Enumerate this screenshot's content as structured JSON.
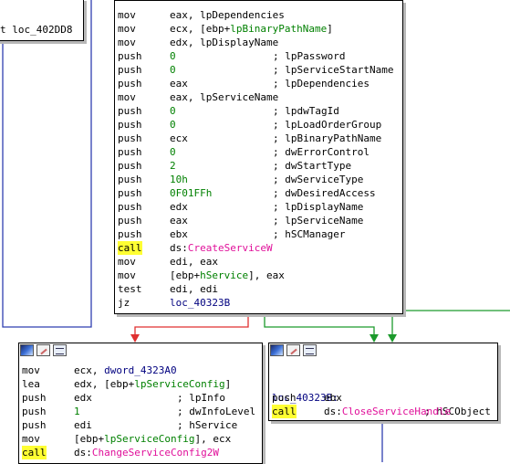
{
  "left_block": {
    "partial_line": "t loc_402DD8"
  },
  "main_block": {
    "lines": [
      {
        "m": "mov",
        "o": "eax, lpDependencies",
        "c": ""
      },
      {
        "m": "mov",
        "o": "ecx, [ebp+lpBinaryPathName]",
        "c": ""
      },
      {
        "m": "mov",
        "o": "edx, lpDisplayName",
        "c": ""
      },
      {
        "m": "push",
        "o": "0",
        "c": "; lpPassword"
      },
      {
        "m": "push",
        "o": "0",
        "c": "; lpServiceStartName"
      },
      {
        "m": "push",
        "o": "eax",
        "c": "; lpDependencies"
      },
      {
        "m": "mov",
        "o": "eax, lpServiceName",
        "c": ""
      },
      {
        "m": "push",
        "o": "0",
        "c": "; lpdwTagId"
      },
      {
        "m": "push",
        "o": "0",
        "c": "; lpLoadOrderGroup"
      },
      {
        "m": "push",
        "o": "ecx",
        "c": "; lpBinaryPathName"
      },
      {
        "m": "push",
        "o": "0",
        "c": "; dwErrorControl"
      },
      {
        "m": "push",
        "o": "2",
        "c": "; dwStartType"
      },
      {
        "m": "push",
        "o": "10h",
        "c": "; dwServiceType"
      },
      {
        "m": "push",
        "o": "0F01FFh",
        "c": "; dwDesiredAccess"
      },
      {
        "m": "push",
        "o": "edx",
        "c": "; lpDisplayName"
      },
      {
        "m": "push",
        "o": "eax",
        "c": "; lpServiceName"
      },
      {
        "m": "push",
        "o": "ebx",
        "c": "; hSCManager"
      },
      {
        "m": "call",
        "o": "ds:CreateServiceW",
        "c": ""
      },
      {
        "m": "mov",
        "o": "edi, eax",
        "c": ""
      },
      {
        "m": "mov",
        "o": "[ebp+hService], eax",
        "c": ""
      },
      {
        "m": "test",
        "o": "edi, edi",
        "c": ""
      },
      {
        "m": "jz",
        "o": "loc_40323B",
        "c": ""
      }
    ]
  },
  "bottom_left_block": {
    "lines": [
      {
        "m": "mov",
        "o": "ecx, dword_4323A0",
        "c": ""
      },
      {
        "m": "lea",
        "o": "edx, [ebp+lpServiceConfig]",
        "c": ""
      },
      {
        "m": "push",
        "o": "edx",
        "c": "; lpInfo"
      },
      {
        "m": "push",
        "o": "1",
        "c": "; dwInfoLevel"
      },
      {
        "m": "push",
        "o": "edi",
        "c": "; hService"
      },
      {
        "m": "mov",
        "o": "[ebp+lpServiceConfig], ecx",
        "c": ""
      },
      {
        "m": "call",
        "o": "ds:ChangeServiceConfig2W",
        "c": ""
      }
    ]
  },
  "bottom_right_block": {
    "label": "loc_40323B:",
    "label_comment": "; hSCObject",
    "lines": [
      {
        "m": "push",
        "o": "ebx",
        "c": ""
      },
      {
        "m": "call",
        "o": "ds:CloseServiceHandle",
        "c": ""
      }
    ]
  },
  "colors": {
    "false_edge": "#e03030",
    "true_edge": "#1c9a2c",
    "flow_edge": "#2f3fb0",
    "highlight": "#ffff33"
  }
}
